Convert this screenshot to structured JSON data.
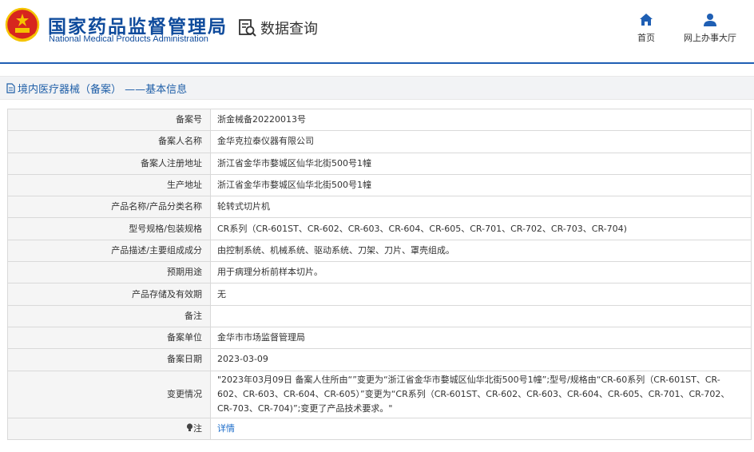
{
  "header": {
    "logo_cn": "国家药品监督管理局",
    "logo_en": "National Medical Products Administration",
    "query_label": "数据查询",
    "nav": [
      {
        "label": "首页",
        "icon": "home-icon"
      },
      {
        "label": "网上办事大厅",
        "icon": "user-icon"
      }
    ]
  },
  "breadcrumb": {
    "icon": "document-icon",
    "text": "境内医疗器械（备案） ——基本信息"
  },
  "rows": [
    {
      "label": "备案号",
      "value": "浙金械备20220013号"
    },
    {
      "label": "备案人名称",
      "value": "金华克拉泰仪器有限公司"
    },
    {
      "label": "备案人注册地址",
      "value": "浙江省金华市婺城区仙华北街500号1幢"
    },
    {
      "label": "生产地址",
      "value": "浙江省金华市婺城区仙华北街500号1幢"
    },
    {
      "label": "产品名称/产品分类名称",
      "value": "轮转式切片机"
    },
    {
      "label": "型号规格/包装规格",
      "value": "CR系列（CR-601ST、CR-602、CR-603、CR-604、CR-605、CR-701、CR-702、CR-703、CR-704)"
    },
    {
      "label": "产品描述/主要组成成分",
      "value": "由控制系统、机械系统、驱动系统、刀架、刀片、罩壳组成。"
    },
    {
      "label": "预期用途",
      "value": "用于病理分析前样本切片。"
    },
    {
      "label": "产品存储及有效期",
      "value": "无"
    },
    {
      "label": "备注",
      "value": ""
    },
    {
      "label": "备案单位",
      "value": "金华市市场监督管理局"
    },
    {
      "label": "备案日期",
      "value": "2023-03-09"
    },
    {
      "label": "变更情况",
      "value": "\"2023年03月09日 备案人住所由“”变更为“浙江省金华市婺城区仙华北街500号1幢”;型号/规格由“CR-60系列（CR-601ST、CR-602、CR-603、CR-604、CR-605）”变更为“CR系列（CR-601ST、CR-602、CR-603、CR-604、CR-605、CR-701、CR-702、CR-703、CR-704)”;变更了产品技术要求。\""
    }
  ],
  "note_row": {
    "label": "注",
    "icon": "bulb-icon",
    "link": "详情"
  },
  "colors": {
    "brand_blue": "#0f4b9c",
    "link_blue": "#1a6bc9",
    "emblem_red": "#d7261e",
    "emblem_gold": "#f5c400"
  }
}
